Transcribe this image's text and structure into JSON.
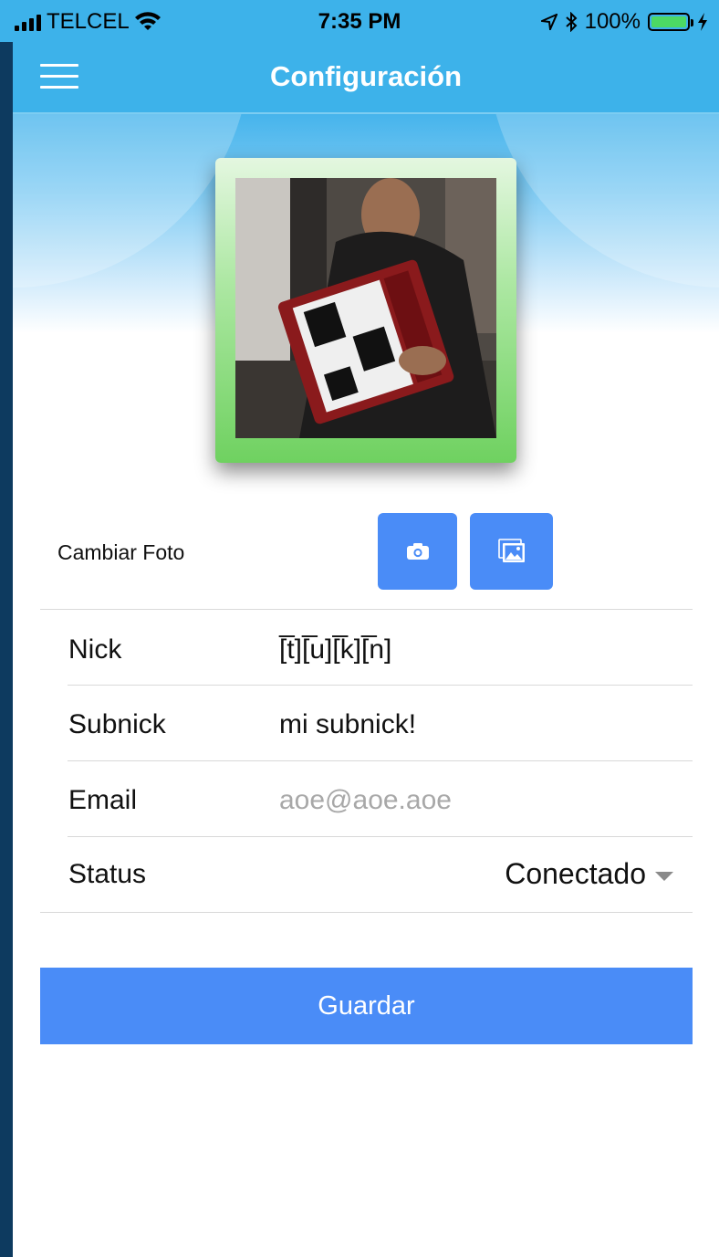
{
  "status_bar": {
    "carrier": "TELCEL",
    "time": "7:35 PM",
    "battery": "100%"
  },
  "header": {
    "title": "Configuración"
  },
  "photo_section": {
    "change_label": "Cambiar Foto"
  },
  "form": {
    "nick_label": "Nick",
    "nick_value": "[̅t][̅u][̅k][̅n]",
    "subnick_label": "Subnick",
    "subnick_value": "mi subnick!",
    "email_label": "Email",
    "email_placeholder": "aoe@aoe.aoe",
    "status_label": "Status",
    "status_value": "Conectado"
  },
  "actions": {
    "save_label": "Guardar"
  },
  "colors": {
    "header_bg": "#3db2ea",
    "button_blue": "#4a8cf7",
    "frame_green": "#6fd160",
    "battery_green": "#4cd964"
  },
  "icons": [
    "menu-icon",
    "camera-icon",
    "gallery-icon",
    "wifi-icon",
    "location-icon",
    "bluetooth-icon",
    "battery-icon",
    "charging-icon",
    "chevron-down-icon"
  ]
}
